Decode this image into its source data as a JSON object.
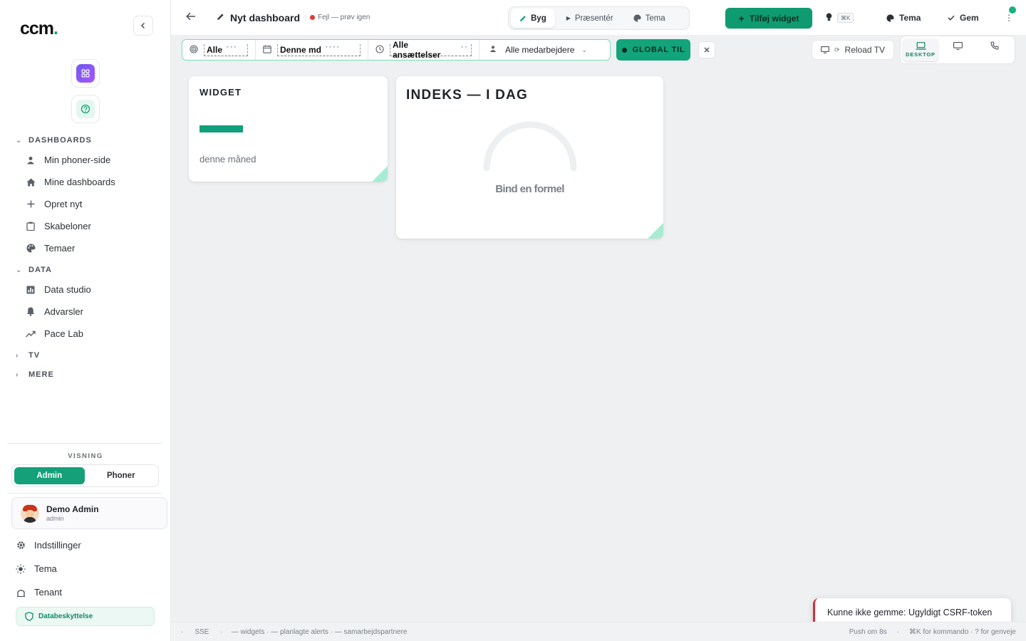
{
  "sidebar": {
    "logo": "ccm",
    "logo_dot": ".",
    "sections": {
      "dashboards": {
        "label": "DASHBOARDS",
        "items": [
          {
            "label": "Min phoner-side"
          },
          {
            "label": "Mine dashboards"
          },
          {
            "label": "Opret nyt"
          },
          {
            "label": "Skabeloner"
          },
          {
            "label": "Temaer"
          }
        ]
      },
      "data": {
        "label": "DATA",
        "items": [
          {
            "label": "Data studio"
          },
          {
            "label": "Advarsler"
          },
          {
            "label": "Pace Lab"
          }
        ]
      },
      "tv": {
        "label": "TV"
      },
      "mere": {
        "label": "MERE"
      }
    },
    "visning": {
      "label": "VISNING",
      "options": [
        "Admin",
        "Phoner"
      ],
      "selected": "Admin"
    },
    "user": {
      "name": "Demo Admin",
      "role": "admin"
    },
    "bottom_items": [
      {
        "label": "Indstillinger"
      },
      {
        "label": "Tema"
      },
      {
        "label": "Tenant"
      }
    ],
    "data_badge": "Databeskyttelse"
  },
  "topbar": {
    "title": "Nyt dashboard",
    "status": "Fejl — prøv igen",
    "modes": [
      "Byg",
      "Præsentér",
      "Tema"
    ],
    "active_mode": "Byg",
    "add_widget": "Tilføj widget",
    "shortcut": "⌘K",
    "theme_label": "Tema",
    "save_label": "Gem"
  },
  "filters": {
    "scope": "Alle",
    "period": "Denne md",
    "employment": "Alle ansættelser",
    "employees": "Alle medarbejdere",
    "global_label": "GLOBAL TIL",
    "reload_tv": "Reload TV",
    "devices": [
      {
        "name": "desktop",
        "label": "DESKTOP",
        "active": true
      },
      {
        "name": "tv",
        "label": "",
        "active": false
      },
      {
        "name": "phone",
        "label": "",
        "active": false
      }
    ]
  },
  "widgets": [
    {
      "title": "WIDGET",
      "subtitle": "denne måned"
    },
    {
      "title": "INDEKS — I DAG",
      "hint": "Bind en formel"
    }
  ],
  "toast": {
    "message": "Kunne ikke gemme: Ugyldigt CSRF-token"
  },
  "footer": {
    "left": [
      "·",
      "SSE",
      "·",
      "— widgets · — planlagte alerts · — samarbejdspartnere"
    ],
    "right": [
      "Push om 8s",
      "·",
      "⌘K for kommando · ? for genveje"
    ]
  },
  "colors": {
    "accent": "#12a07a",
    "error": "#d6303a",
    "online": "#18b37e"
  }
}
